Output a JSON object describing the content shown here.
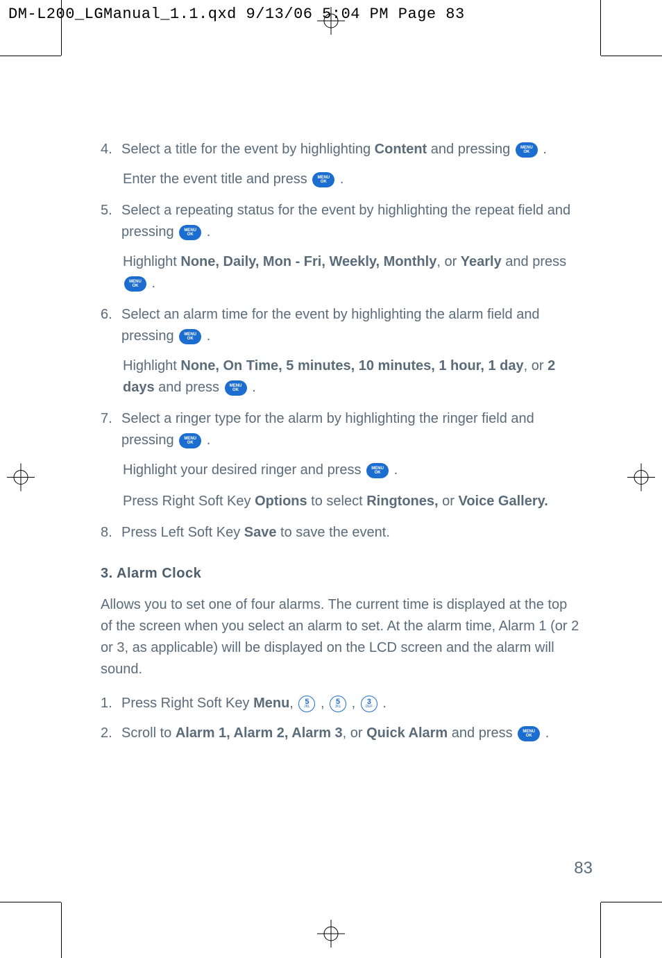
{
  "header": "DM-L200_LGManual_1.1.qxd  9/13/06  5:04 PM  Page 83",
  "step4": {
    "num": "4.",
    "text_a": "Select a title for the event by highlighting ",
    "bold_a": "Content",
    "text_b": " and pressing ",
    "sub_a": "Enter the event title and press "
  },
  "step5": {
    "num": "5.",
    "text_a": "Select a repeating status for the event by highlighting the repeat field and pressing ",
    "sub_a": "Highlight ",
    "bold_a": "None, Daily, Mon - Fri, Weekly, Monthly",
    "sub_b": ", or ",
    "bold_b": "Yearly",
    "sub_c": " and press "
  },
  "step6": {
    "num": "6.",
    "text_a": "Select an alarm time for the event by highlighting the alarm field and pressing ",
    "sub_a": "Highlight ",
    "bold_a": "None, On Time, 5 minutes, 10 minutes, 1 hour, 1 day",
    "sub_b": ", or ",
    "bold_b": "2 days",
    "sub_c": " and press "
  },
  "step7": {
    "num": "7.",
    "text_a": "Select a ringer type for the alarm by highlighting the ringer field and pressing ",
    "sub_a": "Highlight your desired ringer and press ",
    "sub2_a": "Press Right Soft Key ",
    "bold2_a": "Options",
    "sub2_b": " to select ",
    "bold2_b": "Ringtones,",
    "sub2_c": " or ",
    "bold2_c": "Voice Gallery."
  },
  "step8": {
    "num": "8.",
    "text_a": "Press Left Soft Key ",
    "bold_a": "Save",
    "text_b": " to save the event."
  },
  "section": "3. Alarm Clock",
  "para": "Allows you to set one of four alarms. The current time is displayed at the top of the screen when you select an alarm to set. At the alarm time, Alarm 1 (or 2 or 3, as applicable) will be displayed on the LCD screen and the alarm will sound.",
  "astep1": {
    "num": "1.",
    "text_a": "Press Right Soft Key ",
    "bold_a": "Menu",
    "comma": ", "
  },
  "astep2": {
    "num": "2.",
    "text_a": "Scroll to ",
    "bold_a": "Alarm 1, Alarm 2, Alarm 3",
    "text_b": ", or ",
    "bold_b": "Quick Alarm",
    "text_c": " and press "
  },
  "keys": {
    "five": "5",
    "five_sub": "JKL",
    "three": "3",
    "three_sub": "DEF"
  },
  "menu_label_top": "MENU",
  "menu_label_bot": "OK",
  "page": "83"
}
